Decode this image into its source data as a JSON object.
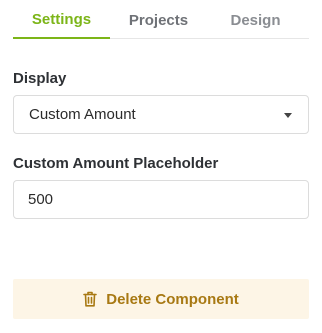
{
  "tabs": [
    {
      "label": "Settings",
      "active": true
    },
    {
      "label": "Projects",
      "active": false
    },
    {
      "label": "Design",
      "active": false
    }
  ],
  "display": {
    "label": "Display",
    "selected": "Custom Amount",
    "icon": "chevron-down-icon"
  },
  "placeholder_field": {
    "label": "Custom Amount Placeholder",
    "value": "500"
  },
  "delete": {
    "label": "Delete Component",
    "icon": "trash-icon"
  },
  "colors": {
    "accent": "#7cb518",
    "delete_text": "#a87913",
    "delete_bg": "#fdf5e6"
  }
}
